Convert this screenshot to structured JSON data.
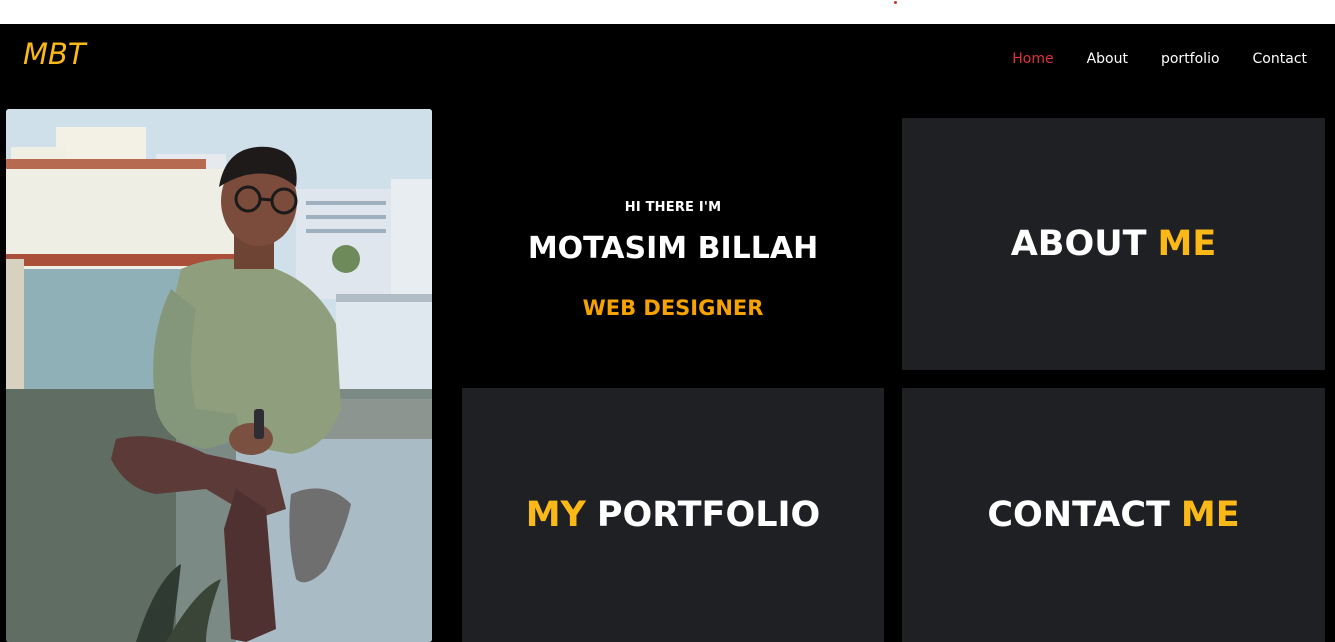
{
  "colors": {
    "background": "#000000",
    "accent": "#fbb917",
    "role": "#f6a200",
    "nav_active": "#e0323b",
    "card": "#1f2024",
    "text": "#ffffff"
  },
  "navbar": {
    "brand": "MBT",
    "links": [
      {
        "label": "Home",
        "active": true
      },
      {
        "label": "About",
        "active": false
      },
      {
        "label": "portfolio",
        "active": false
      },
      {
        "label": "Contact",
        "active": false
      }
    ]
  },
  "hero": {
    "greeting": "HI THERE I'M",
    "name": "MOTASIM BILLAH",
    "role": "WEB DESIGNER",
    "photo_alt": "profile-photo"
  },
  "cards": {
    "about": {
      "word_white": "ABOUT",
      "word_accent": "ME"
    },
    "portfolio": {
      "word_accent": "MY",
      "word_white": "PORTFOLIO"
    },
    "contact": {
      "word_white": "CONTACT",
      "word_accent": "ME"
    }
  }
}
